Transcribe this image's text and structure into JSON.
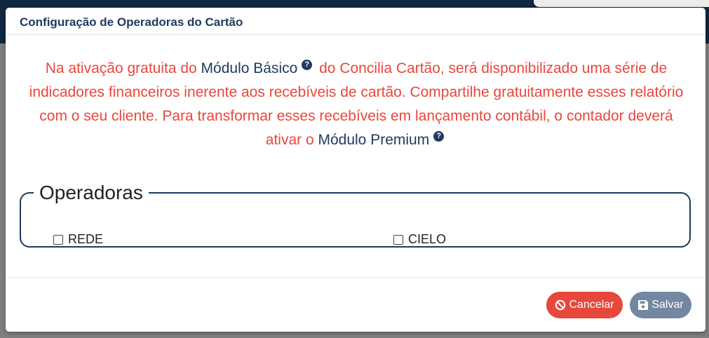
{
  "modal": {
    "title": "Configuração de Operadoras do Cartão"
  },
  "info": {
    "part1": "Na ativação gratuita do ",
    "basic_module": "Módulo Básico",
    "part2": " do Concilia Cartão, será disponibilizado uma série de indicadores financeiros inerente aos recebíveis de cartão. Compartilhe gratuitamente esses relatório com o seu cliente. Para transformar esses recebíveis em lançamento contábil, o contador deverá ativar o ",
    "premium_module": "Módulo Premium",
    "help_glyph": "?"
  },
  "operators": {
    "legend": "Operadoras",
    "items": [
      {
        "label": "REDE",
        "checked": false
      },
      {
        "label": "CIELO",
        "checked": false
      }
    ]
  },
  "footer": {
    "cancel_label": "Cancelar",
    "save_label": "Salvar"
  },
  "colors": {
    "title": "#1e3a5f",
    "info_text": "#e8473b",
    "cancel": "#e8473b",
    "save": "#7388a0"
  },
  "icons": {
    "help": "question-circle-icon",
    "cancel": "ban-icon",
    "save": "floppy-disk-icon"
  }
}
